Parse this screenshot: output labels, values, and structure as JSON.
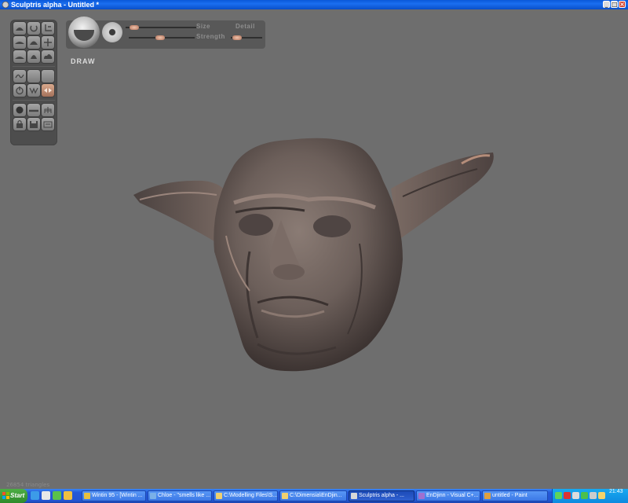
{
  "window": {
    "title": "Sculptris alpha - Untitled *",
    "buttons": {
      "minimize": "_",
      "maximize": "□",
      "close": "×"
    }
  },
  "toolbar": {
    "tools": [
      "draw-tool",
      "inflate-tool",
      "crease-tool",
      "flatten-tool",
      "pinch-tool",
      "grab-tool",
      "smooth-tool",
      "reduce-tool",
      "paint-tool",
      "curve-tool",
      "tool-blank-1",
      "tool-blank-2",
      "power-tool",
      "symmetry-tool",
      "mirror-tool",
      "material-tool",
      "plane-tool",
      "grid-tool",
      "lock-tool",
      "save-tool",
      "settings-tool"
    ],
    "active_tool": "mirror-tool"
  },
  "brush": {
    "mode_label": "DRAW",
    "size_label": "Size",
    "detail_label": "Detail",
    "strength_label": "Strength",
    "size_value": 0.12,
    "strength_value": 0.48,
    "detail_value": 0.2
  },
  "status": {
    "triangles": "26854 triangles"
  },
  "taskbar": {
    "start_label": "Start",
    "quick_launch": [
      "ie-icon",
      "outlook-icon",
      "messenger-icon",
      "media-icon"
    ],
    "tasks": [
      {
        "label": "Wintin 95 - [Wintin ...",
        "icon_color": "#e8c040"
      },
      {
        "label": "Chloe - \"smells like ...",
        "icon_color": "#7ab0e8"
      },
      {
        "label": "C:\\Modelling Files\\S...",
        "icon_color": "#f0d070"
      },
      {
        "label": "C:\\Dimensia\\EnDjin...",
        "icon_color": "#f0d070"
      },
      {
        "label": "Sculptris alpha - ...",
        "icon_color": "#d8d8d8",
        "active": true
      },
      {
        "label": "EnDjinn - Visual C+...",
        "icon_color": "#a070d0"
      },
      {
        "label": "untitled - Paint",
        "icon_color": "#e0a040"
      }
    ],
    "tray_icons": [
      "network-icon",
      "antivirus-icon",
      "security-icon",
      "messenger-tray-icon",
      "volume-icon",
      "update-icon"
    ],
    "clock": "21:43"
  }
}
